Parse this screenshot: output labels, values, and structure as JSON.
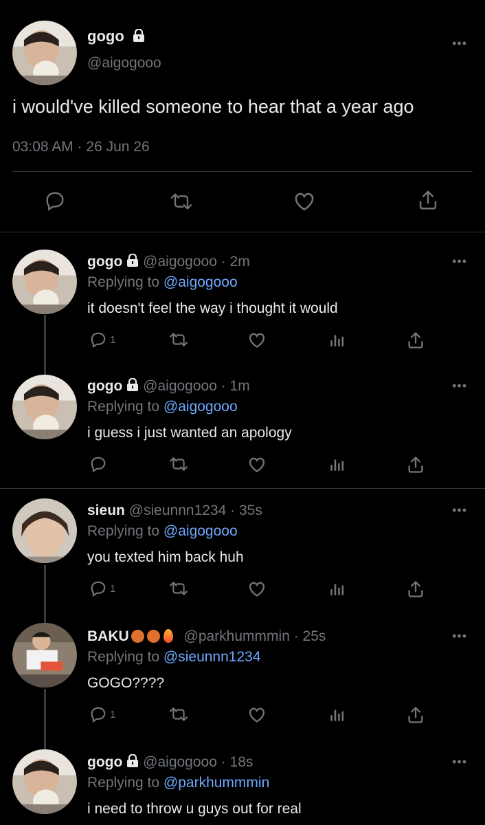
{
  "main_tweet": {
    "display_name": "gogo",
    "handle": "@aigogooo",
    "text": "i would've killed someone to hear that a year ago",
    "time": "03:08 AM · 26 Jun 26",
    "more": "•••"
  },
  "replies": [
    {
      "display_name": "gogo",
      "handle_time": "@aigogooo · 2m",
      "replying_label": "Replying to",
      "replying_to": "@aigogooo",
      "text": "it doesn't feel the way i thought it would",
      "reply_count": "1",
      "more": "•••"
    },
    {
      "display_name": "gogo",
      "handle_time": "@aigogooo · 1m",
      "replying_label": "Replying to",
      "replying_to": "@aigogooo",
      "text": "i guess i just wanted an apology",
      "reply_count": "",
      "more": "•••"
    },
    {
      "display_name": "sieun",
      "handle_time": "@sieunnn1234 · 35s",
      "replying_label": "Replying to",
      "replying_to": "@aigogooo",
      "text": "you texted him back huh",
      "reply_count": "1",
      "more": "•••"
    },
    {
      "display_name": "BAKU",
      "handle_time": "@parkhummmin · 25s",
      "replying_label": "Replying to",
      "replying_to": "@sieunnn1234",
      "text": "GOGO????",
      "reply_count": "1",
      "more": "•••"
    },
    {
      "display_name": "gogo",
      "handle_time": "@aigogooo · 18s",
      "replying_label": "Replying to",
      "replying_to": "@parkhummmin",
      "text": "i need to throw u guys out for real",
      "reply_count": "",
      "more": "•••"
    }
  ],
  "colors": {
    "background": "#000000",
    "text": "#e7e9ea",
    "muted": "#71767b",
    "link": "#6ea8fe",
    "divider": "#2f3336"
  }
}
